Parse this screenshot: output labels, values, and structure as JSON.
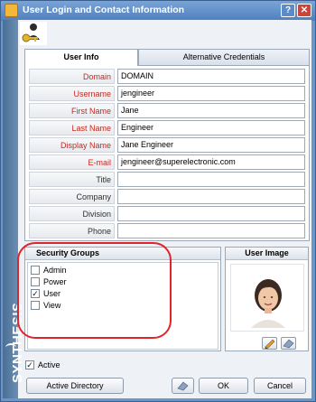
{
  "window": {
    "title": "User Login and Contact Information",
    "help_label": "?",
    "close_label": "✕"
  },
  "brand": {
    "name": "SYNTHESIS"
  },
  "tabs": [
    {
      "label": "User Info"
    },
    {
      "label": "Alternative Credentials"
    }
  ],
  "fields": [
    {
      "label": "Domain",
      "value": "DOMAIN",
      "required": true
    },
    {
      "label": "Username",
      "value": "jengineer",
      "required": true
    },
    {
      "label": "First Name",
      "value": "Jane",
      "required": true
    },
    {
      "label": "Last Name",
      "value": "Engineer",
      "required": true
    },
    {
      "label": "Display Name",
      "value": "Jane Engineer",
      "required": true
    },
    {
      "label": "E-mail",
      "value": "jengineer@superelectronic.com",
      "required": true
    },
    {
      "label": "Title",
      "value": "",
      "required": false
    },
    {
      "label": "Company",
      "value": "",
      "required": false
    },
    {
      "label": "Division",
      "value": "",
      "required": false
    },
    {
      "label": "Phone",
      "value": "",
      "required": false
    }
  ],
  "security_groups": {
    "title": "Security Groups",
    "items": [
      {
        "label": "Admin",
        "checked": false
      },
      {
        "label": "Power",
        "checked": false
      },
      {
        "label": "User",
        "checked": true
      },
      {
        "label": "View",
        "checked": false
      }
    ]
  },
  "user_image": {
    "title": "User Image"
  },
  "active": {
    "label": "Active",
    "checked": true
  },
  "buttons": {
    "active_directory": "Active Directory",
    "ok": "OK",
    "cancel": "Cancel"
  },
  "colors": {
    "required_label": "#c8281e",
    "titlebar": "#4e7fbd",
    "annotation": "#e0242a"
  },
  "check_mark": "✓"
}
